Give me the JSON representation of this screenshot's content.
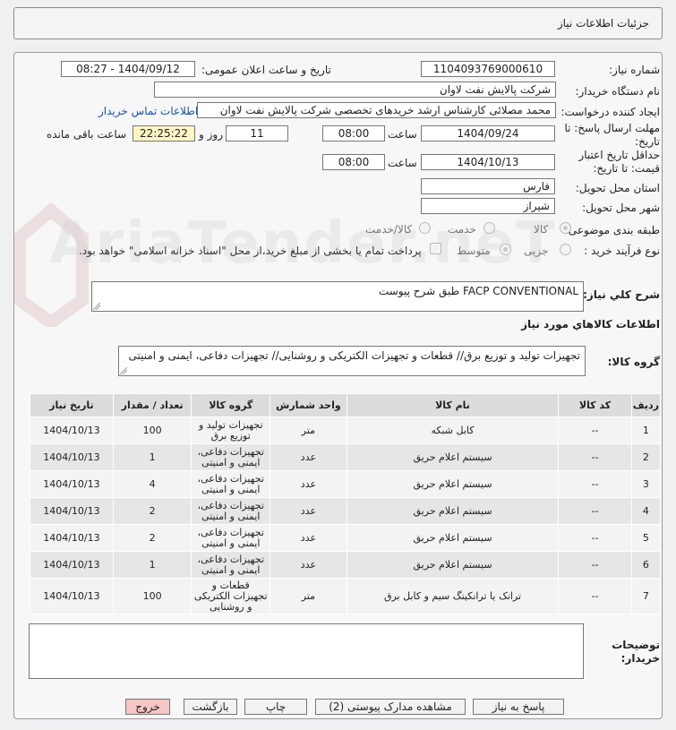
{
  "header": {
    "title": "جزئیات اطلاعات نیاز"
  },
  "form": {
    "need_number_label": "شماره نیاز:",
    "need_number": "1104093769000610",
    "announce_label": "تاریخ و ساعت اعلان عمومی:",
    "announce_value": "1404/09/12 - 08:27",
    "buyer_org_label": "نام دستگاه خریدار:",
    "buyer_org": "شرکت پالایش نفت لاوان",
    "creator_label": "ایجاد کننده درخواست:",
    "creator": "محمد مصلائی کارشناس ارشد خریدهای تخصصی شرکت پالایش نفت لاوان",
    "contact_link": "اطلاعات تماس خریدار",
    "reply_deadline_label": "مهلت ارسال پاسخ: تا تاریخ:",
    "reply_date": "1404/09/24",
    "time_label": "ساعت",
    "reply_time": "08:00",
    "days_value": "11",
    "days_label": "روز و",
    "remaining_time": "22:25:22",
    "remaining_label": "ساعت باقی مانده",
    "validity_label": "حداقل تاریخ اعتبار قیمت: تا تاریخ:",
    "validity_date": "1404/10/13",
    "validity_time": "08:00",
    "province_label": "استان محل تحویل:",
    "province": "فارس",
    "city_label": "شهر محل تحویل:",
    "city": "شیراز",
    "category_label": "طبقه بندی موضوعی:",
    "category_options": [
      "کالا",
      "خدمت",
      "کالا/خدمت"
    ],
    "process_label": "نوع فرآیند خرید :",
    "process_options": [
      "جزیی",
      "متوسط"
    ],
    "payment_note": "پرداخت تمام یا بخشی از مبلغ خرید،از محل \"اسناد خزانه اسلامی\" خواهد بود.",
    "description_label": "شرح کلي نياز:",
    "description": "FACP CONVENTIONAL طبق شرح پیوست",
    "goods_info_title": "اطلاعات کالاهاي مورد نياز",
    "goods_group_label": "گروه کالا:",
    "goods_group": "تجهیزات تولید و توزیع برق// قطعات و تجهیزات الکتریکی و روشنایی// تجهیزات دفاعی، ایمنی و امنیتی",
    "buyer_notes_label": "توضیحات خریدار:"
  },
  "table": {
    "headers": [
      "ردیف",
      "کد کالا",
      "نام کالا",
      "واحد شمارش",
      "گروه کالا",
      "تعداد / مقدار",
      "تاریخ نیاز"
    ],
    "rows": [
      [
        "1",
        "--",
        "کابل شبکه",
        "متر",
        "تجهیزات تولید و توزیع برق",
        "100",
        "1404/10/13"
      ],
      [
        "2",
        "--",
        "سیستم اعلام حریق",
        "عدد",
        "تجهیزات دفاعی، ایمنی و امنیتی",
        "1",
        "1404/10/13"
      ],
      [
        "3",
        "--",
        "سیستم اعلام حریق",
        "عدد",
        "تجهیزات دفاعی، ایمنی و امنیتی",
        "4",
        "1404/10/13"
      ],
      [
        "4",
        "--",
        "سیستم اعلام حریق",
        "عدد",
        "تجهیزات دفاعی، ایمنی و امنیتی",
        "2",
        "1404/10/13"
      ],
      [
        "5",
        "--",
        "سیستم اعلام حریق",
        "عدد",
        "تجهیزات دفاعی، ایمنی و امنیتی",
        "2",
        "1404/10/13"
      ],
      [
        "6",
        "--",
        "سیستم اعلام حریق",
        "عدد",
        "تجهیزات دفاعی، ایمنی و امنیتی",
        "1",
        "1404/10/13"
      ],
      [
        "7",
        "--",
        "ترانک یا ترانکینگ سیم و کابل برق",
        "متر",
        "قطعات و تجهیزات الکتریکی و روشنایی",
        "100",
        "1404/10/13"
      ]
    ]
  },
  "buttons": {
    "reply": "پاسخ به نیاز",
    "docs": "مشاهده مدارک پیوستی (2)",
    "print": "چاپ",
    "back": "بازگشت",
    "exit": "خروج"
  },
  "watermark": "AriaTender.neT",
  "colors": {
    "link": "#1a4fb5",
    "yellow_field": "#fdf6c3",
    "exit_button": "#f6c6c6"
  }
}
